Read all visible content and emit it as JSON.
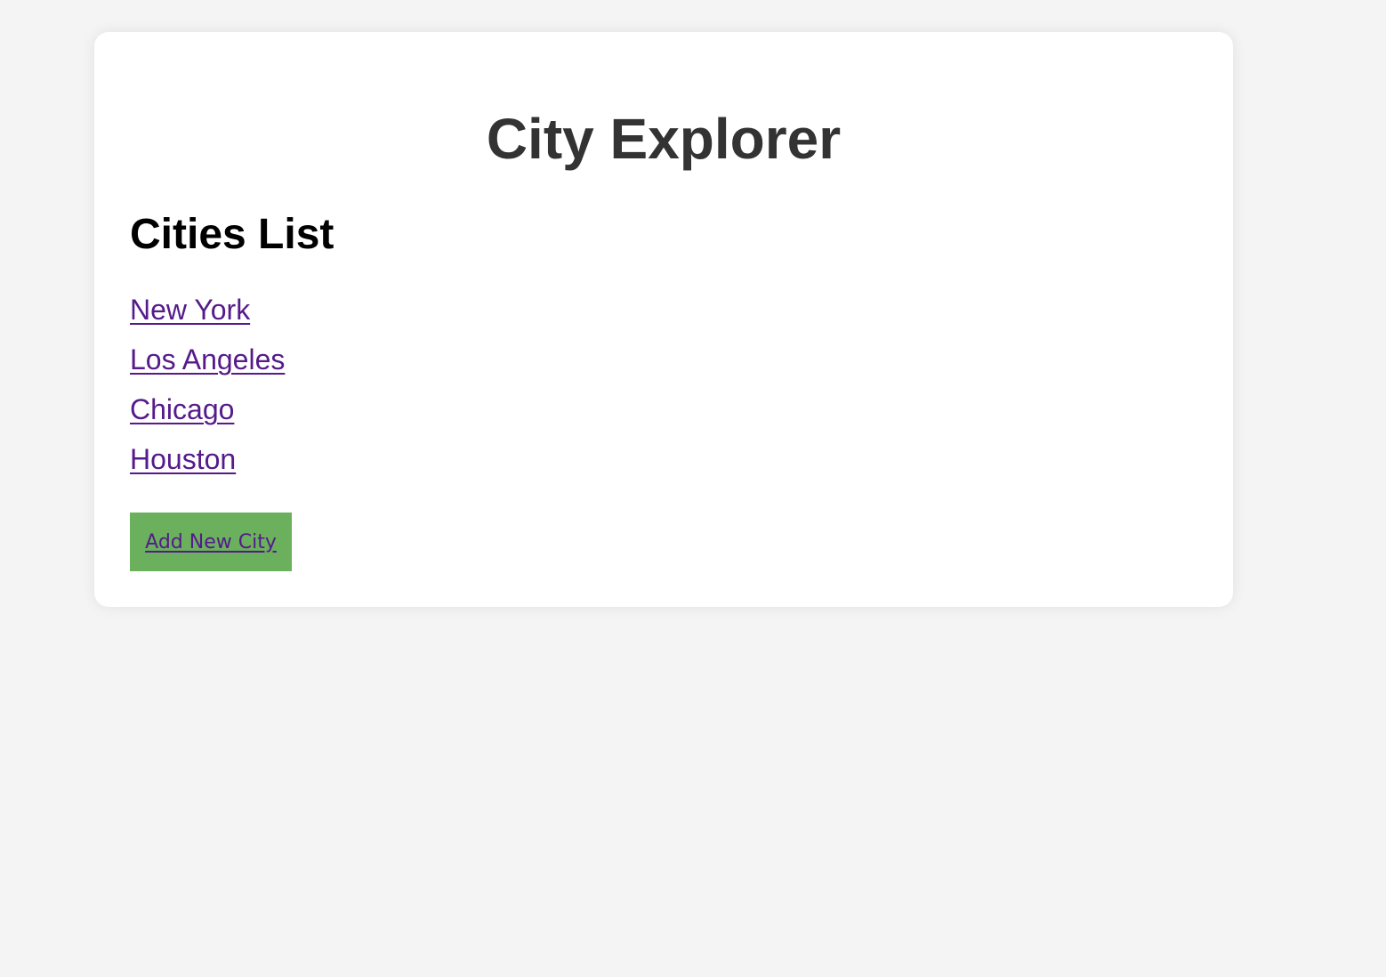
{
  "page": {
    "title": "City Explorer"
  },
  "cities_section": {
    "heading": "Cities List",
    "items": [
      {
        "label": "New York"
      },
      {
        "label": "Los Angeles"
      },
      {
        "label": "Chicago"
      },
      {
        "label": "Houston"
      }
    ]
  },
  "actions": {
    "add_label": "Add New City"
  },
  "colors": {
    "background": "#f4f4f4",
    "card": "#ffffff",
    "title": "#333333",
    "link": "#551a8b",
    "button": "#6ab05d"
  }
}
